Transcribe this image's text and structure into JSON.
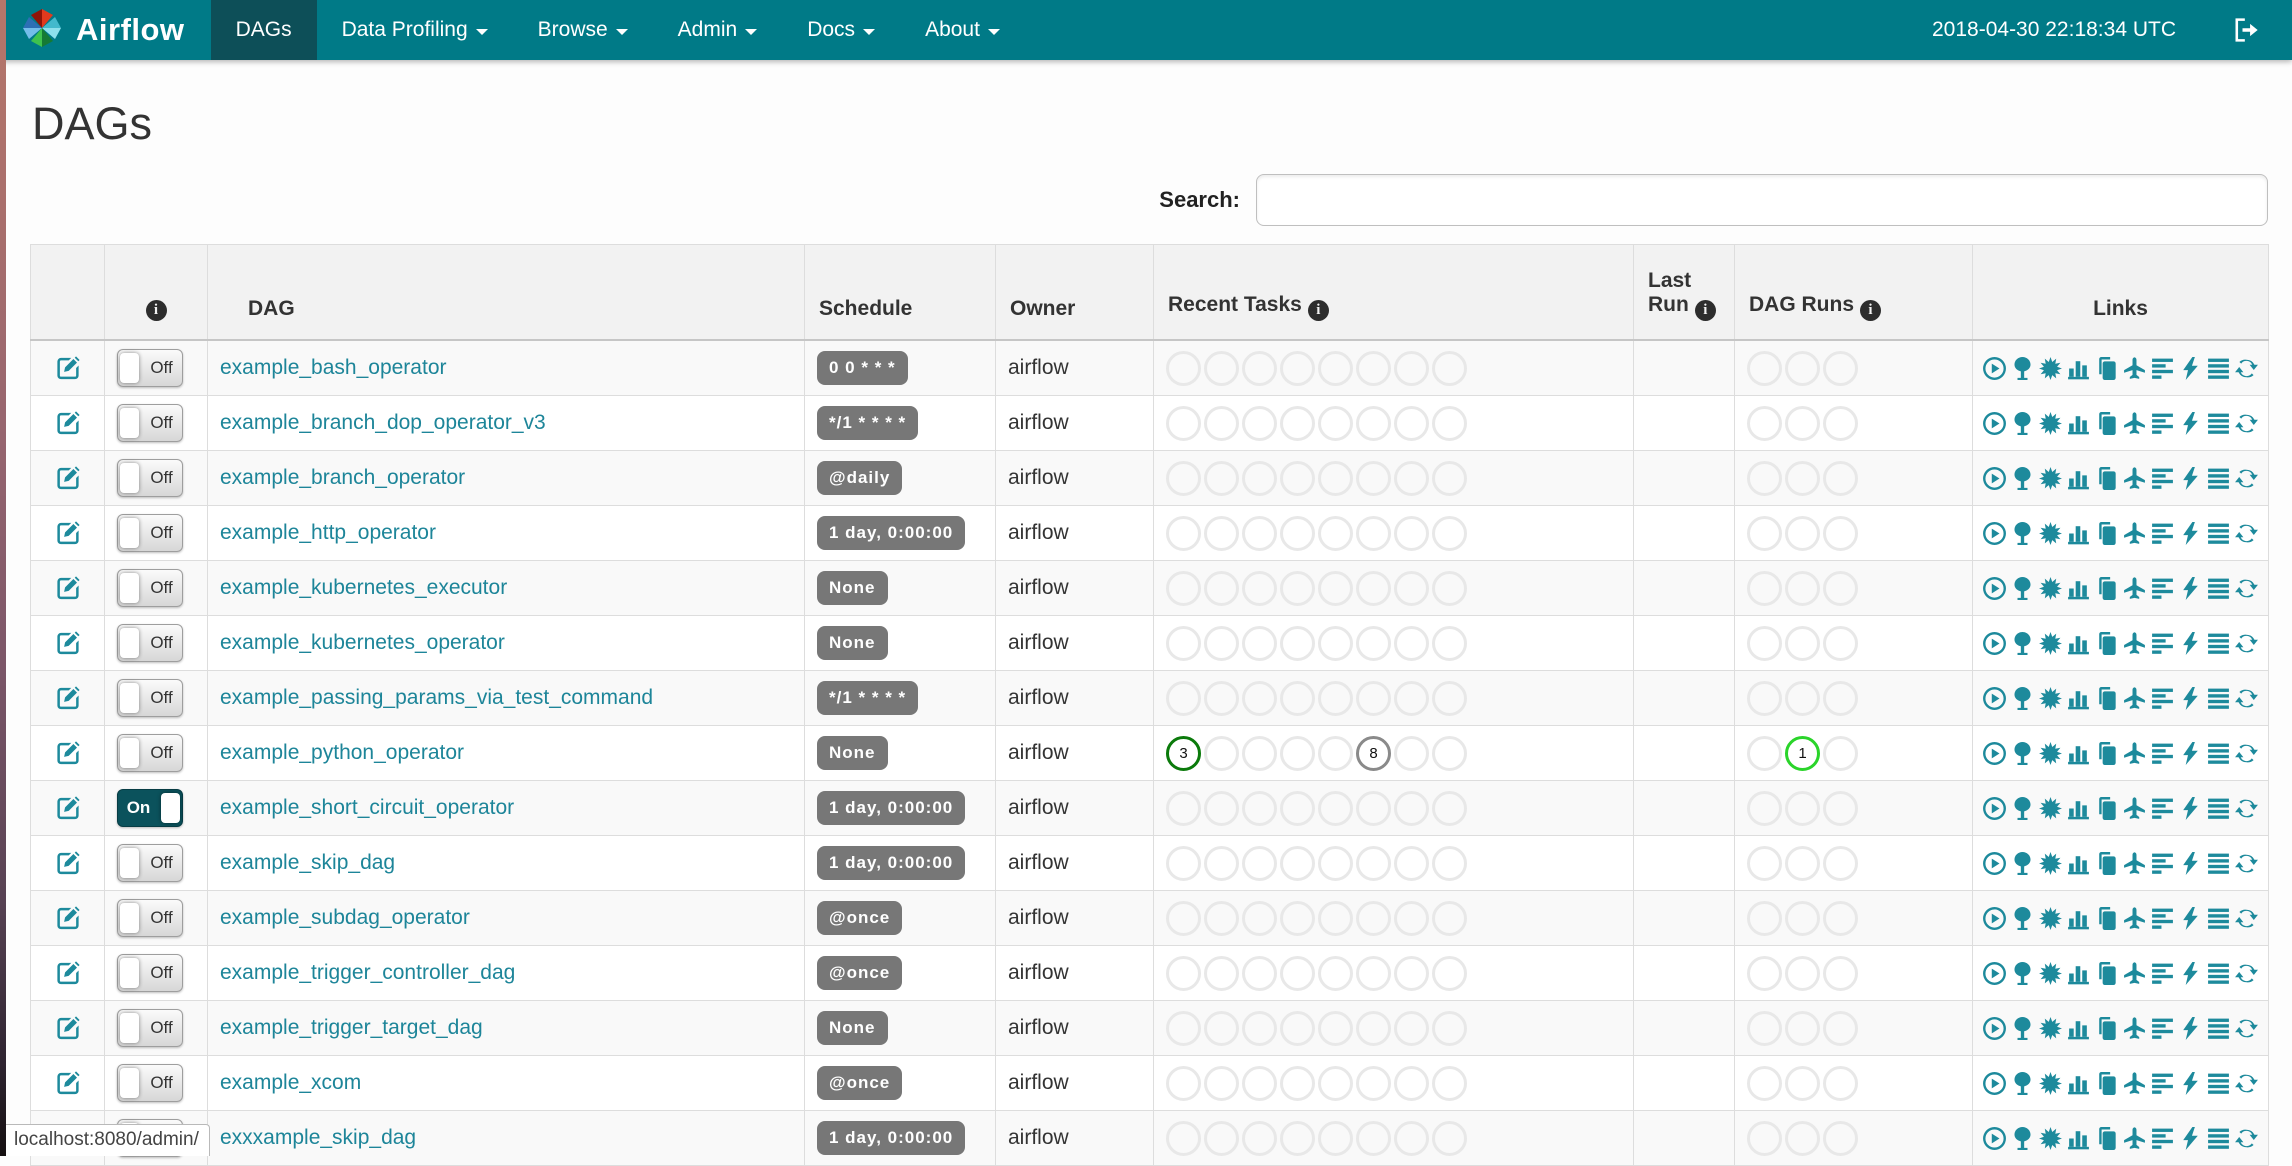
{
  "navbar": {
    "brand": "Airflow",
    "items": [
      {
        "label": "DAGs",
        "active": true,
        "caret": false
      },
      {
        "label": "Data Profiling",
        "active": false,
        "caret": true
      },
      {
        "label": "Browse",
        "active": false,
        "caret": true
      },
      {
        "label": "Admin",
        "active": false,
        "caret": true
      },
      {
        "label": "Docs",
        "active": false,
        "caret": true
      },
      {
        "label": "About",
        "active": false,
        "caret": true
      }
    ],
    "clock": "2018-04-30 22:18:34 UTC"
  },
  "page": {
    "title": "DAGs",
    "search_label": "Search:",
    "search_value": "",
    "status_bar": "localhost:8080/admin/"
  },
  "table": {
    "headers": {
      "info_glyph": "i",
      "dag": "DAG",
      "schedule": "Schedule",
      "owner": "Owner",
      "recent_tasks": "Recent Tasks",
      "last_run": "Last Run",
      "dag_runs": "DAG Runs",
      "links": "Links"
    },
    "state_colors": {
      "success": "#0b7a0b",
      "running": "#2ad42a",
      "queued": "#8a8a8a",
      "none": "#e8e8e8"
    },
    "recent_task_slots": 8,
    "dag_run_slots": 3,
    "links_icons": [
      "trigger-dag",
      "tree-view",
      "graph-view",
      "task-duration",
      "task-tries",
      "landing-times",
      "gantt-view",
      "code-view",
      "logs",
      "refresh-dag"
    ],
    "rows": [
      {
        "toggle": "Off",
        "name": "example_bash_operator",
        "schedule": "0 0 * * *",
        "owner": "airflow",
        "last_run": "",
        "recent_tasks": [],
        "dag_runs": []
      },
      {
        "toggle": "Off",
        "name": "example_branch_dop_operator_v3",
        "schedule": "*/1 * * * *",
        "owner": "airflow",
        "last_run": "",
        "recent_tasks": [],
        "dag_runs": []
      },
      {
        "toggle": "Off",
        "name": "example_branch_operator",
        "schedule": "@daily",
        "owner": "airflow",
        "last_run": "",
        "recent_tasks": [],
        "dag_runs": []
      },
      {
        "toggle": "Off",
        "name": "example_http_operator",
        "schedule": "1 day, 0:00:00",
        "owner": "airflow",
        "last_run": "",
        "recent_tasks": [],
        "dag_runs": []
      },
      {
        "toggle": "Off",
        "name": "example_kubernetes_executor",
        "schedule": "None",
        "owner": "airflow",
        "last_run": "",
        "recent_tasks": [],
        "dag_runs": []
      },
      {
        "toggle": "Off",
        "name": "example_kubernetes_operator",
        "schedule": "None",
        "owner": "airflow",
        "last_run": "",
        "recent_tasks": [],
        "dag_runs": []
      },
      {
        "toggle": "Off",
        "name": "example_passing_params_via_test_command",
        "schedule": "*/1 * * * *",
        "owner": "airflow",
        "last_run": "",
        "recent_tasks": [],
        "dag_runs": []
      },
      {
        "toggle": "Off",
        "name": "example_python_operator",
        "schedule": "None",
        "owner": "airflow",
        "last_run": "",
        "recent_tasks": [
          {
            "slot": 0,
            "count": "3",
            "state": "success"
          },
          {
            "slot": 5,
            "count": "8",
            "state": "queued"
          }
        ],
        "dag_runs": [
          {
            "slot": 1,
            "count": "1",
            "state": "running"
          }
        ]
      },
      {
        "toggle": "On",
        "name": "example_short_circuit_operator",
        "schedule": "1 day, 0:00:00",
        "owner": "airflow",
        "last_run": "",
        "recent_tasks": [],
        "dag_runs": []
      },
      {
        "toggle": "Off",
        "name": "example_skip_dag",
        "schedule": "1 day, 0:00:00",
        "owner": "airflow",
        "last_run": "",
        "recent_tasks": [],
        "dag_runs": []
      },
      {
        "toggle": "Off",
        "name": "example_subdag_operator",
        "schedule": "@once",
        "owner": "airflow",
        "last_run": "",
        "recent_tasks": [],
        "dag_runs": []
      },
      {
        "toggle": "Off",
        "name": "example_trigger_controller_dag",
        "schedule": "@once",
        "owner": "airflow",
        "last_run": "",
        "recent_tasks": [],
        "dag_runs": []
      },
      {
        "toggle": "Off",
        "name": "example_trigger_target_dag",
        "schedule": "None",
        "owner": "airflow",
        "last_run": "",
        "recent_tasks": [],
        "dag_runs": []
      },
      {
        "toggle": "Off",
        "name": "example_xcom",
        "schedule": "@once",
        "owner": "airflow",
        "last_run": "",
        "recent_tasks": [],
        "dag_runs": []
      },
      {
        "toggle": "Off",
        "name": "exxxample_skip_dag",
        "schedule": "1 day, 0:00:00",
        "owner": "airflow",
        "last_run": "",
        "recent_tasks": [],
        "dag_runs": []
      }
    ]
  }
}
